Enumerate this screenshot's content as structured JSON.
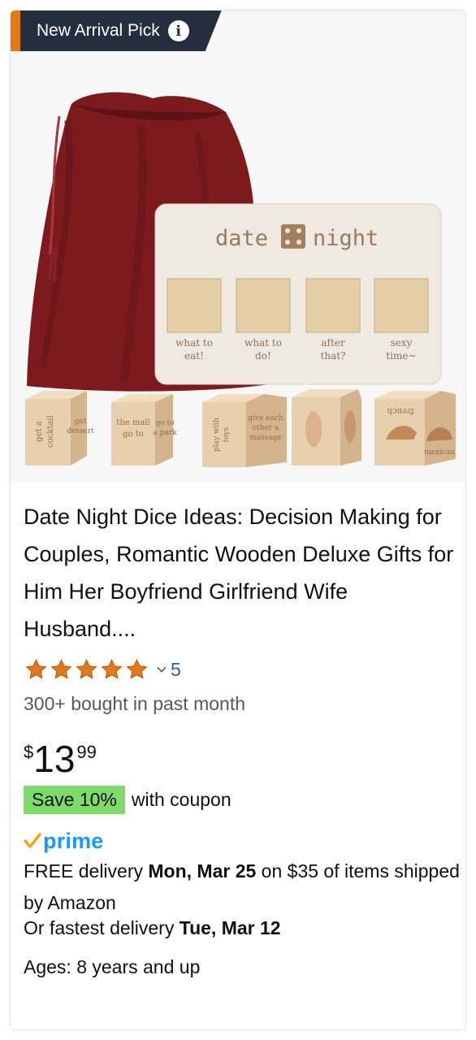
{
  "badge": {
    "label": "New Arrival Pick",
    "info_icon": "info-icon"
  },
  "product_image": {
    "board": {
      "word_left": "date",
      "word_right": "night",
      "slot_labels": [
        [
          "what to",
          "eat!"
        ],
        [
          "what to",
          "do!"
        ],
        [
          "after",
          "that?"
        ],
        [
          "sexy",
          "time~"
        ]
      ]
    },
    "dice_labels": [
      [
        "get a",
        "cocktail"
      ],
      [
        "get",
        "dessert"
      ],
      [
        "go to",
        "a park"
      ],
      [
        "play with",
        "toys"
      ],
      [
        "give each",
        "other a",
        "massage"
      ],
      [],
      [
        "french",
        "mexican"
      ]
    ],
    "colors": {
      "bag": "#7d1a1e",
      "wood": "#e8cfae",
      "board": "#efe9e2"
    }
  },
  "title": "Date Night Dice Ideas: Decision Making for Couples, Romantic Wooden Deluxe Gifts for Him Her Boyfriend Girlfriend Wife Husband....",
  "rating": {
    "stars": 5,
    "count": "5",
    "icon": "star-icon"
  },
  "bought": "300+ bought in past month",
  "price": {
    "symbol": "$",
    "whole": "13",
    "fraction": "99"
  },
  "coupon": {
    "badge": "Save 10%",
    "text": "with coupon",
    "color": "#7fda69"
  },
  "prime": {
    "label": "prime",
    "color": "#1399ff"
  },
  "delivery": {
    "prefix": "FREE delivery ",
    "date": "Mon, Mar 25",
    "suffix": " on $35 of items shipped by Amazon"
  },
  "fastest": {
    "prefix": "Or fastest delivery ",
    "date": "Tue, Mar 12"
  },
  "ages": "Ages: 8 years and up"
}
